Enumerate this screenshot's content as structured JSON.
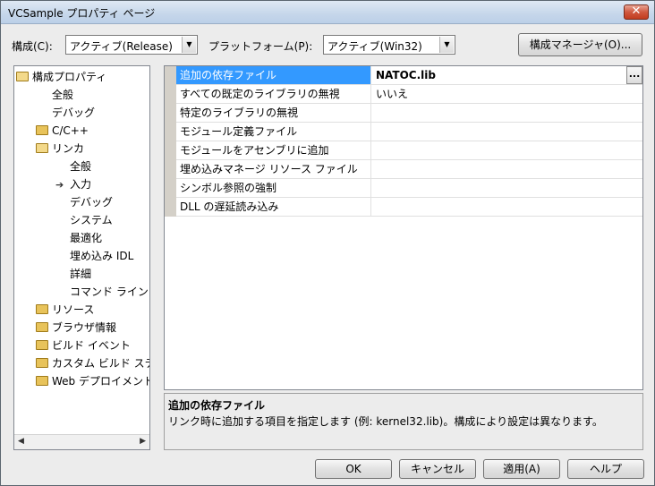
{
  "window": {
    "title": "VCSample プロパティ ページ",
    "close_glyph": "✕"
  },
  "toolbar": {
    "config_label": "構成(C):",
    "config_value": "アクティブ(Release)",
    "platform_label": "プラットフォーム(P):",
    "platform_value": "アクティブ(Win32)",
    "config_manager_label": "構成マネージャ(O)..."
  },
  "tree": {
    "items": [
      {
        "label": "構成プロパティ",
        "icon": "open-folder-icon"
      },
      {
        "label": "全般"
      },
      {
        "label": "デバッグ"
      },
      {
        "label": "C/C++",
        "icon": "folder-icon"
      },
      {
        "label": "リンカ",
        "icon": "open-folder-icon"
      },
      {
        "label": "全般"
      },
      {
        "label": "入力",
        "icon": "arrow-icon"
      },
      {
        "label": "デバッグ"
      },
      {
        "label": "システム"
      },
      {
        "label": "最適化"
      },
      {
        "label": "埋め込み IDL"
      },
      {
        "label": "詳細"
      },
      {
        "label": "コマンド ライン"
      },
      {
        "label": "リソース",
        "icon": "folder-icon"
      },
      {
        "label": "ブラウザ情報",
        "icon": "folder-icon"
      },
      {
        "label": "ビルド イベント",
        "icon": "folder-icon"
      },
      {
        "label": "カスタム ビルド ステ",
        "icon": "folder-icon"
      },
      {
        "label": "Web デプロイメント",
        "icon": "folder-icon"
      }
    ],
    "scroll_left": "◀",
    "scroll_right": "▶"
  },
  "properties": [
    {
      "name": "追加の依存ファイル",
      "value": "NATOC.lib"
    },
    {
      "name": "すべての既定のライブラリの無視",
      "value": "いいえ"
    },
    {
      "name": "特定のライブラリの無視",
      "value": ""
    },
    {
      "name": "モジュール定義ファイル",
      "value": ""
    },
    {
      "name": "モジュールをアセンブリに追加",
      "value": ""
    },
    {
      "name": "埋め込みマネージ リソース ファイル",
      "value": ""
    },
    {
      "name": "シンボル参照の強制",
      "value": ""
    },
    {
      "name": "DLL の遅延読み込み",
      "value": ""
    }
  ],
  "ellipsis": "...",
  "description": {
    "title": "追加の依存ファイル",
    "body": "リンク時に追加する項目を指定します (例: kernel32.lib)。構成により設定は異なります。"
  },
  "buttons": {
    "ok": "OK",
    "cancel": "キャンセル",
    "apply": "適用(A)",
    "help": "ヘルプ"
  },
  "colors": {
    "selection": "#3399ff",
    "gutter": "#d4d0c8"
  }
}
